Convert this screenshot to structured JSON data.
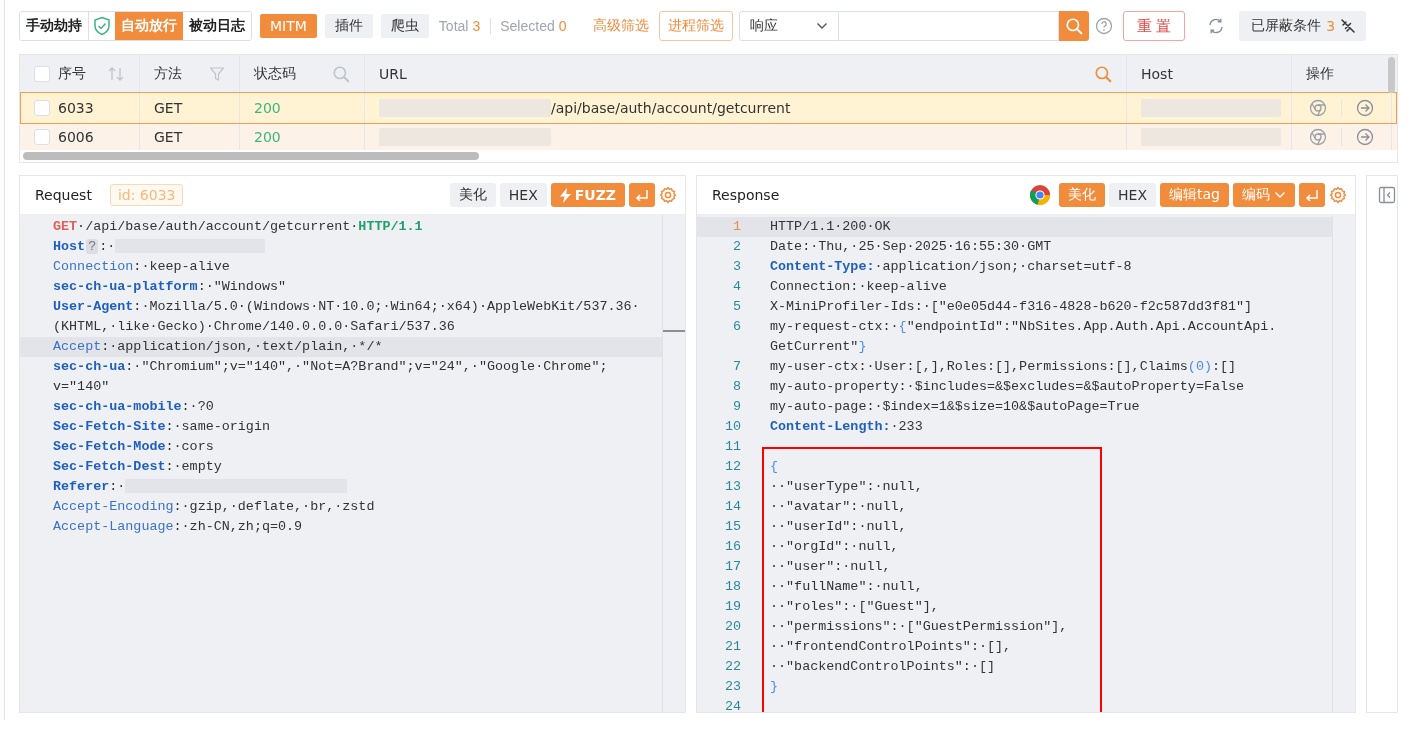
{
  "toolbar": {
    "modes": [
      {
        "label": "手动劫持",
        "selected": false
      },
      {
        "label": "自动放行",
        "selected": true
      },
      {
        "label": "被动日志",
        "selected": false
      }
    ],
    "tools": [
      {
        "label": "MITM",
        "selected": true
      },
      {
        "label": "插件",
        "selected": false
      },
      {
        "label": "爬虫",
        "selected": false
      }
    ],
    "total_label": "Total",
    "total": "3",
    "selected_label": "Selected",
    "selected_count": "0",
    "advanced_filter": "高级筛选",
    "process_filter": "进程筛选",
    "scope_select": "响应",
    "reset": "重 置",
    "blocked_label": "已屏蔽条件",
    "blocked_count": "3"
  },
  "table": {
    "select_all_checked": false,
    "columns": [
      {
        "label": "序号"
      },
      {
        "label": "方法"
      },
      {
        "label": "状态码"
      },
      {
        "label": "URL"
      },
      {
        "label": "Host"
      },
      {
        "label": "操作"
      }
    ],
    "rows": [
      {
        "seq": "6033",
        "method": "GET",
        "status": "200",
        "url": "/api/base/auth/account/getcurrent",
        "checked": false,
        "selected": true
      },
      {
        "seq": "6006",
        "method": "GET",
        "status": "200",
        "checked": false,
        "selected": false
      }
    ]
  },
  "request": {
    "title": "Request",
    "id_badge": "id: 6033",
    "buttons": [
      {
        "kind": "text",
        "label": "美化",
        "selected": false
      },
      {
        "kind": "text",
        "label": "HEX",
        "selected": false
      },
      {
        "kind": "fuzz",
        "label": "FUZZ",
        "selected": true
      },
      {
        "kind": "wrap",
        "selected": true
      }
    ],
    "lines": [
      {
        "active": false,
        "segments": [
          {
            "kind": "method",
            "text": "GET"
          },
          {
            "kind": "text",
            "text": "·/api/base/auth/account/getcurrent·"
          },
          {
            "kind": "proto",
            "text": "HTTP/1.1"
          }
        ]
      },
      {
        "active": false,
        "segments": [
          {
            "kind": "keyb",
            "text": "Host"
          },
          {
            "kind": "badge",
            "text": "?"
          },
          {
            "kind": "text",
            "text": ":·"
          },
          {
            "kind": "redacted"
          }
        ]
      },
      {
        "active": false,
        "segments": [
          {
            "kind": "key",
            "text": "Connection"
          },
          {
            "kind": "text",
            "text": ":·keep-alive"
          }
        ]
      },
      {
        "active": false,
        "segments": [
          {
            "kind": "keyb",
            "text": "sec-ch-ua-platform"
          },
          {
            "kind": "text",
            "text": ":·\"Windows\""
          }
        ]
      },
      {
        "active": false,
        "segments": [
          {
            "kind": "keyb",
            "text": "User-Agent"
          },
          {
            "kind": "text",
            "text": ":·Mozilla/5.0·(Windows·NT·10.0;·Win64;·x64)·AppleWebKit/537.36· (KHTML,·like·Gecko)·Chrome/140.0.0.0·Safari/537.36"
          }
        ]
      },
      {
        "active": true,
        "segments": [
          {
            "kind": "key",
            "text": "Accept"
          },
          {
            "kind": "text",
            "text": ":·application/json,·text/plain,·*/*"
          }
        ]
      },
      {
        "active": false,
        "segments": [
          {
            "kind": "keyb",
            "text": "sec-ch-ua"
          },
          {
            "kind": "text",
            "text": ":·\"Chromium\";v=\"140\",·\"Not=A?Brand\";v=\"24\",·\"Google·Chrome\"; v=\"140\""
          }
        ]
      },
      {
        "active": false,
        "segments": [
          {
            "kind": "keyb",
            "text": "sec-ch-ua-mobile"
          },
          {
            "kind": "text",
            "text": ":·?0"
          }
        ]
      },
      {
        "active": false,
        "segments": [
          {
            "kind": "keyb",
            "text": "Sec-Fetch-Site"
          },
          {
            "kind": "text",
            "text": ":·same-origin"
          }
        ]
      },
      {
        "active": false,
        "segments": [
          {
            "kind": "keyb",
            "text": "Sec-Fetch-Mode"
          },
          {
            "kind": "text",
            "text": ":·cors"
          }
        ]
      },
      {
        "active": false,
        "segments": [
          {
            "kind": "keyb",
            "text": "Sec-Fetch-Dest"
          },
          {
            "kind": "text",
            "text": ":·empty"
          }
        ]
      },
      {
        "active": false,
        "segments": [
          {
            "kind": "keyb",
            "text": "Referer"
          },
          {
            "kind": "text",
            "text": ":·"
          },
          {
            "kind": "redacted-long"
          }
        ]
      },
      {
        "active": false,
        "segments": [
          {
            "kind": "key",
            "text": "Accept-Encoding"
          },
          {
            "kind": "text",
            "text": ":·gzip,·deflate,·br,·zstd"
          }
        ]
      },
      {
        "active": false,
        "segments": [
          {
            "kind": "key",
            "text": "Accept-Language"
          },
          {
            "kind": "text",
            "text": ":·zh-CN,zh;q=0.9"
          }
        ]
      }
    ]
  },
  "response": {
    "title": "Response",
    "browser_icon": true,
    "buttons": [
      {
        "kind": "text",
        "label": "美化",
        "selected": true
      },
      {
        "kind": "text",
        "label": "HEX",
        "selected": false
      },
      {
        "kind": "text",
        "label": "编辑tag",
        "selected": true
      },
      {
        "kind": "dropdown",
        "label": "编码",
        "selected": true
      },
      {
        "kind": "wrap",
        "selected": true
      }
    ],
    "lines": [
      {
        "n": "1",
        "active": true,
        "segments": [
          {
            "kind": "text",
            "text": "HTTP/1.1·200·OK"
          }
        ]
      },
      {
        "n": "2",
        "active": false,
        "segments": [
          {
            "kind": "text",
            "text": "Date:·Thu,·25·Sep·2025·16:55:30·GMT"
          }
        ]
      },
      {
        "n": "3",
        "active": false,
        "segments": [
          {
            "kind": "keyb",
            "text": "Content-Type:"
          },
          {
            "kind": "text",
            "text": "·application/json;·charset=utf-8"
          }
        ]
      },
      {
        "n": "4",
        "active": false,
        "segments": [
          {
            "kind": "text",
            "text": "Connection:·keep-alive"
          }
        ]
      },
      {
        "n": "5",
        "active": false,
        "segments": [
          {
            "kind": "text",
            "text": "X-MiniProfiler-Ids:·[\"e0e05d44-f316-4828-b620-f2c587dd3f81\"]"
          }
        ]
      },
      {
        "n": "6",
        "active": false,
        "segments": [
          {
            "kind": "text",
            "text": "my-request-ctx:·"
          },
          {
            "kind": "brace",
            "text": "{"
          },
          {
            "kind": "text",
            "text": "\"endpointId\":\"NbSites.App.Auth.Api.AccountApi. GetCurrent\""
          },
          {
            "kind": "brace",
            "text": "}"
          }
        ]
      },
      {
        "n": "7",
        "active": false,
        "segments": [
          {
            "kind": "text",
            "text": "my-user-ctx:·User:[,],Roles:[],Permissions:[],Claims"
          },
          {
            "kind": "brace",
            "text": "(0)"
          },
          {
            "kind": "text",
            "text": ":[]"
          }
        ]
      },
      {
        "n": "8",
        "active": false,
        "segments": [
          {
            "kind": "text",
            "text": "my-auto-property:·$includes=&$excludes=&$autoProperty=False"
          }
        ]
      },
      {
        "n": "9",
        "active": false,
        "segments": [
          {
            "kind": "text",
            "text": "my-auto-page:·$index=1&$size=10&$autoPage=True"
          }
        ]
      },
      {
        "n": "10",
        "active": false,
        "segments": [
          {
            "kind": "keyb",
            "text": "Content-Length:"
          },
          {
            "kind": "text",
            "text": "·233"
          }
        ]
      },
      {
        "n": "11",
        "active": false
      }
    ],
    "highlight_frame": {
      "lines": [
        {
          "n": "12",
          "active": false,
          "segments": [
            {
              "kind": "brace",
              "text": "{"
            }
          ]
        },
        {
          "n": "13",
          "active": false,
          "segments": [
            {
              "kind": "text",
              "text": "··\"userType\":·null,"
            }
          ]
        },
        {
          "n": "14",
          "active": false,
          "segments": [
            {
              "kind": "text",
              "text": "··\"avatar\":·null,"
            }
          ]
        },
        {
          "n": "15",
          "active": false,
          "segments": [
            {
              "kind": "text",
              "text": "··\"userId\":·null,"
            }
          ]
        },
        {
          "n": "16",
          "active": false,
          "segments": [
            {
              "kind": "text",
              "text": "··\"orgId\":·null,"
            }
          ]
        },
        {
          "n": "17",
          "active": false,
          "segments": [
            {
              "kind": "text",
              "text": "··\"user\":·null,"
            }
          ]
        },
        {
          "n": "18",
          "active": false,
          "segments": [
            {
              "kind": "text",
              "text": "··\"fullName\":·null,"
            }
          ]
        },
        {
          "n": "19",
          "active": false,
          "segments": [
            {
              "kind": "text",
              "text": "··\"roles\":·[\"Guest\"],"
            }
          ]
        },
        {
          "n": "20",
          "active": false,
          "segments": [
            {
              "kind": "text",
              "text": "··\"permissions\":·[\"GuestPermission\"],"
            }
          ]
        },
        {
          "n": "21",
          "active": false,
          "segments": [
            {
              "kind": "text",
              "text": "··\"frontendControlPoints\":·[],"
            }
          ]
        },
        {
          "n": "22",
          "active": false,
          "segments": [
            {
              "kind": "text",
              "text": "··\"backendControlPoints\":·[]"
            }
          ]
        },
        {
          "n": "23",
          "active": false,
          "segments": [
            {
              "kind": "brace",
              "text": "}"
            }
          ]
        },
        {
          "n": "24",
          "active": false
        }
      ]
    }
  }
}
